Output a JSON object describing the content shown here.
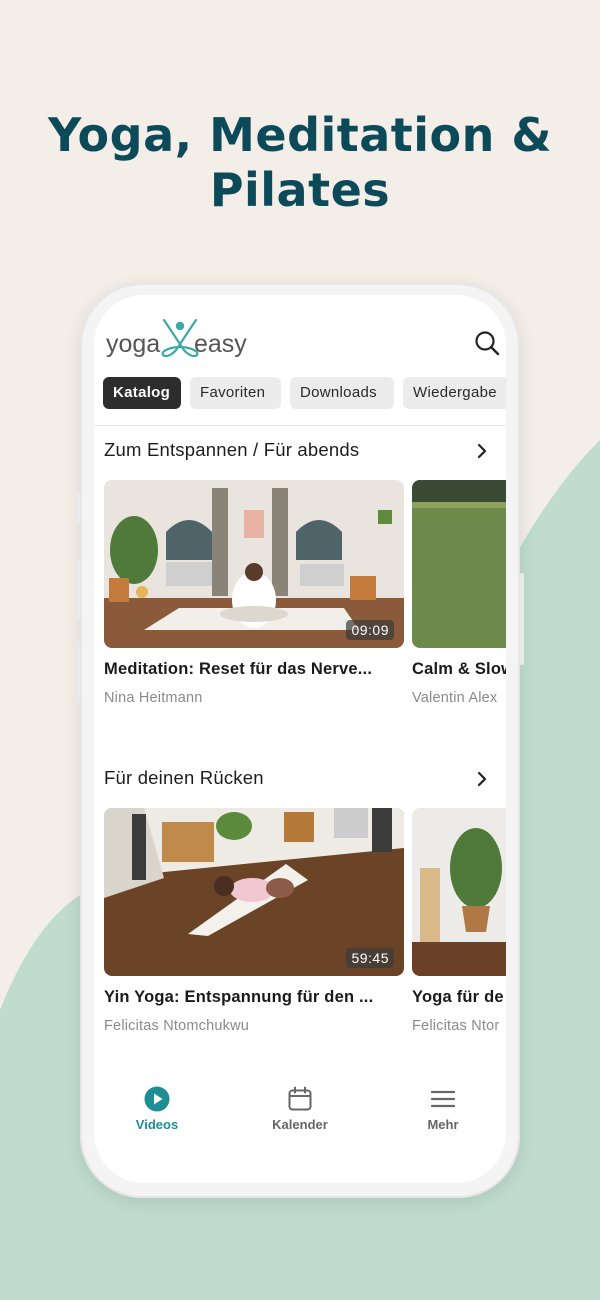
{
  "headline": {
    "line1": "Yoga, Meditation &",
    "line2": "Pilates"
  },
  "app": {
    "logo": {
      "left": "yoga",
      "right": "easy"
    },
    "tabs": [
      {
        "label": "Katalog",
        "active": true
      },
      {
        "label": "Favoriten",
        "active": false
      },
      {
        "label": "Downloads",
        "active": false
      },
      {
        "label": "Wiedergabe",
        "active": false
      }
    ],
    "sections": [
      {
        "title": "Zum Entspannen / Für abends",
        "cards": [
          {
            "title": "Meditation: Reset für das Nerve...",
            "author": "Nina Heitmann",
            "duration": "09:09"
          },
          {
            "title": "Calm & Slow",
            "author": "Valentin Alex",
            "duration": ""
          }
        ]
      },
      {
        "title": "Für deinen Rücken",
        "cards": [
          {
            "title": "Yin Yoga: Entspannung für den ...",
            "author": "Felicitas Ntomchukwu",
            "duration": "59:45"
          },
          {
            "title": "Yoga für de",
            "author": "Felicitas Ntor",
            "duration": ""
          }
        ]
      }
    ],
    "bottom_nav": [
      {
        "label": "Videos",
        "icon": "play-circle-icon",
        "active": true
      },
      {
        "label": "Kalender",
        "icon": "calendar-icon",
        "active": false
      },
      {
        "label": "Mehr",
        "icon": "menu-icon",
        "active": false
      }
    ]
  },
  "colors": {
    "background": "#f3eee7",
    "wave": "#bfdccf",
    "headline": "#0c4a5a",
    "accent": "#1d8e94",
    "logo": "#3ba9a4"
  }
}
